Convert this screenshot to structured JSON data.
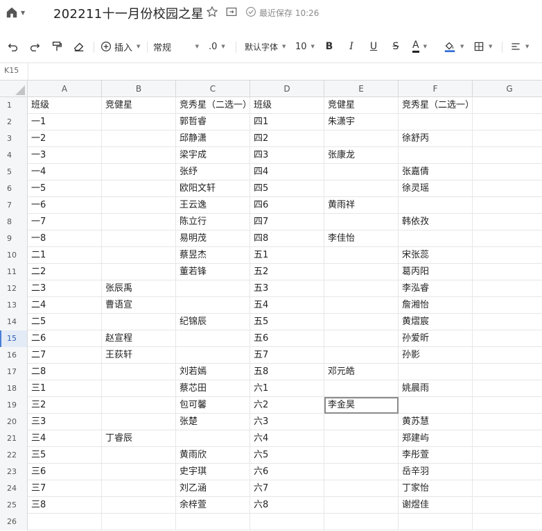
{
  "title_bar": {
    "doc_title": "202211十一月份校园之星",
    "save_status": "最近保存 10:26"
  },
  "toolbar": {
    "insert_label": "插入",
    "number_format": "常规",
    "decimal_label": ".0",
    "font_name": "默认字体",
    "font_size": "10",
    "bold_label": "B",
    "italic_label": "I",
    "underline_label": "U",
    "strike_label": "S",
    "font_color_label": "A",
    "font_color": "#222222",
    "fill_color": "#2f6bd8"
  },
  "name_box": {
    "ref": "K15"
  },
  "columns": [
    "A",
    "B",
    "C",
    "D",
    "E",
    "F",
    "G"
  ],
  "selected_cell": {
    "row": 19,
    "col": "E"
  },
  "active_row": 15,
  "rows": [
    {
      "n": "1",
      "cells": [
        "班级",
        "竞健星",
        "竞秀星（二选一）",
        "班级",
        "竞健星",
        "竞秀星（二选一）",
        ""
      ]
    },
    {
      "n": "2",
      "cells": [
        "一1",
        "",
        "郭哲睿",
        "四1",
        "朱潇宇",
        "",
        ""
      ]
    },
    {
      "n": "3",
      "cells": [
        "一2",
        "",
        "邱静潇",
        "四2",
        "",
        "徐舒丙",
        ""
      ]
    },
    {
      "n": "4",
      "cells": [
        "一3",
        "",
        "梁宇成",
        "四3",
        "张康龙",
        "",
        ""
      ]
    },
    {
      "n": "5",
      "cells": [
        "一4",
        "",
        "张纾",
        "四4",
        "",
        "张嘉倩",
        ""
      ]
    },
    {
      "n": "6",
      "cells": [
        "一5",
        "",
        "欧阳文轩",
        "四5",
        "",
        "徐灵瑶",
        ""
      ]
    },
    {
      "n": "7",
      "cells": [
        "一6",
        "",
        "王云逸",
        "四6",
        "黄雨祥",
        "",
        ""
      ]
    },
    {
      "n": "8",
      "cells": [
        "一7",
        "",
        "陈立行",
        "四7",
        "",
        "韩依孜",
        ""
      ]
    },
    {
      "n": "9",
      "cells": [
        "一8",
        "",
        "易明茂",
        "四8",
        "李佳怡",
        "",
        ""
      ]
    },
    {
      "n": "10",
      "cells": [
        "二1",
        "",
        "蔡昱杰",
        "五1",
        "",
        "宋张蕊",
        ""
      ]
    },
    {
      "n": "11",
      "cells": [
        "二2",
        "",
        "董若锋",
        "五2",
        "",
        "葛丙阳",
        ""
      ]
    },
    {
      "n": "12",
      "cells": [
        "二3",
        "张辰禹",
        "",
        "五3",
        "",
        "李泓睿",
        ""
      ]
    },
    {
      "n": "13",
      "cells": [
        "二4",
        "曹语宣",
        "",
        "五4",
        "",
        "詹湘怡",
        ""
      ]
    },
    {
      "n": "14",
      "cells": [
        "二5",
        "",
        "纪锦辰",
        "五5",
        "",
        "黄熠宸",
        ""
      ]
    },
    {
      "n": "15",
      "cells": [
        "二6",
        "赵宣程",
        "",
        "五6",
        "",
        "孙爱昕",
        ""
      ]
    },
    {
      "n": "16",
      "cells": [
        "二7",
        "王荻轩",
        "",
        "五7",
        "",
        "孙影",
        ""
      ]
    },
    {
      "n": "17",
      "cells": [
        "二8",
        "",
        "刘若嫣",
        "五8",
        "邓元皓",
        "",
        ""
      ]
    },
    {
      "n": "18",
      "cells": [
        "三1",
        "",
        "蔡芯田",
        "六1",
        "",
        "姚晨雨",
        ""
      ]
    },
    {
      "n": "19",
      "cells": [
        "三2",
        "",
        "包可馨",
        "六2",
        "李金昊",
        "",
        ""
      ]
    },
    {
      "n": "20",
      "cells": [
        "三3",
        "",
        "张楚",
        "六3",
        "",
        "黄苏慧",
        ""
      ]
    },
    {
      "n": "21",
      "cells": [
        "三4",
        "丁睿辰",
        "",
        "六4",
        "",
        "郑建屿",
        ""
      ]
    },
    {
      "n": "22",
      "cells": [
        "三5",
        "",
        "黄雨欣",
        "六5",
        "",
        "李彤萱",
        ""
      ]
    },
    {
      "n": "23",
      "cells": [
        "三6",
        "",
        "史宇琪",
        "六6",
        "",
        "岳辛羽",
        ""
      ]
    },
    {
      "n": "24",
      "cells": [
        "三7",
        "",
        "刘乙涵",
        "六7",
        "",
        "丁家怡",
        ""
      ]
    },
    {
      "n": "25",
      "cells": [
        "三8",
        "",
        "余梓萱",
        "六8",
        "",
        "谢煜佳",
        ""
      ]
    },
    {
      "n": "26",
      "cells": [
        "",
        "",
        "",
        "",
        "",
        "",
        ""
      ]
    }
  ]
}
